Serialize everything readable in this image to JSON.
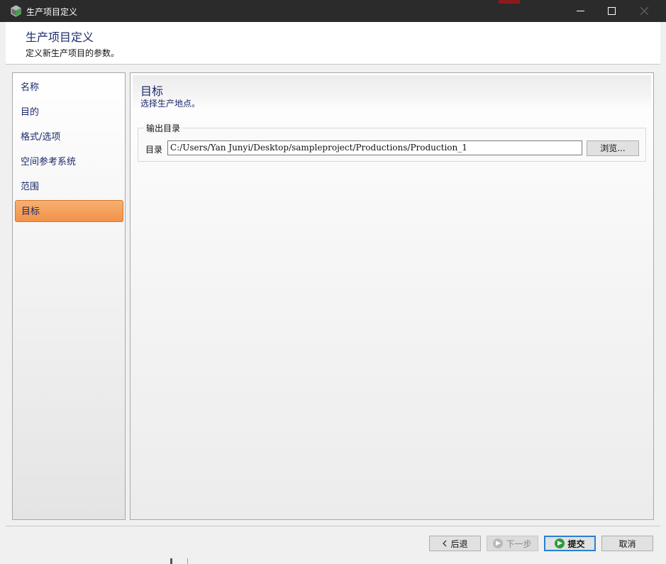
{
  "window": {
    "title": "生产项目定义",
    "icon": "app-cube-icon",
    "controls": [
      "minimize-icon",
      "maximize-icon",
      "close-icon"
    ]
  },
  "header": {
    "title": "生产项目定义",
    "subtitle": "定义新生产项目的参数。"
  },
  "nav": {
    "items": [
      {
        "label": "名称"
      },
      {
        "label": "目的"
      },
      {
        "label": "格式/选项"
      },
      {
        "label": "空间参考系统"
      },
      {
        "label": "范围"
      },
      {
        "label": "目标",
        "active": true
      }
    ]
  },
  "content": {
    "title": "目标",
    "subtitle": "选择生产地点。",
    "group": {
      "legend": "输出目录",
      "dir_label": "目录",
      "dir_value": "C:/Users/Yan Junyi/Desktop/sampleproject/Productions/Production_1",
      "browse_label": "浏览..."
    }
  },
  "footer": {
    "back_label": "后退",
    "next_label": "下一步",
    "submit_label": "提交",
    "cancel_label": "取消"
  },
  "colors": {
    "titlebar": "#2b2b2b",
    "accent_active": "#f19148",
    "heading_text": "#1b2a6b",
    "submit_border": "#2a7fd4"
  }
}
